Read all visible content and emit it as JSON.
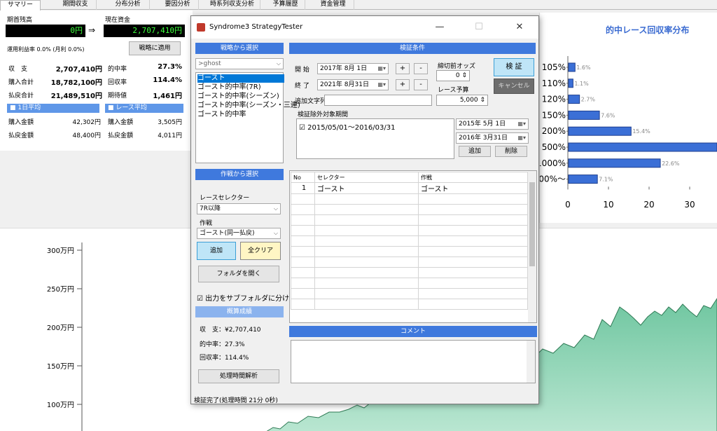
{
  "tabs": [
    "サマリー",
    "期間収支",
    "分布分析",
    "要因分析",
    "時系列収支分析",
    "予算履歴",
    "資金管理"
  ],
  "summary": {
    "initial_label": "期首残高",
    "initial_value": "0円",
    "current_label": "現在資金",
    "current_value": "2,707,410円",
    "arrow": "⇒",
    "rate_label": "運用利益率 0.0% (月利 0.0%)",
    "apply_button": "戦略に適用",
    "rows": [
      {
        "label": "収　支",
        "value": "2,707,410円",
        "label2": "的中率",
        "value2": "27.3%"
      },
      {
        "label": "購入合計",
        "value": "18,782,100円",
        "label2": "回収率",
        "value2": "114.4%"
      },
      {
        "label": "払戻合計",
        "value": "21,489,510円",
        "label2": "期待値",
        "value2": "1,461円"
      }
    ],
    "daily_avg_label": "■ 1日平均",
    "race_avg_label": "■ レース平均",
    "avg_rows": [
      {
        "label": "購入金額",
        "value": "42,302円",
        "label2": "購入金額",
        "value2": "3,505円"
      },
      {
        "label": "払戻金額",
        "value": "48,400円",
        "label2": "払戻金額",
        "value2": "4,011円"
      }
    ]
  },
  "window": {
    "title": "Syndrome3 StrategyTester",
    "minimize": "—",
    "maximize": "☐",
    "close": "✕",
    "strategy_select_header": "戦略から選択",
    "strategy_dropdown": ">ghost",
    "strategy_list": [
      "ゴースト",
      "ゴースト的中率(7R)",
      "ゴースト的中率(シーズン)",
      "ゴースト的中率(シーズン・三連)",
      "ゴースト的中率"
    ],
    "conditions_header": "検証条件",
    "start_label": "開 始",
    "start_date": "2017年 8月 1日",
    "end_label": "終 了",
    "end_date": "2021年 8月31日",
    "plus": "+",
    "minus": "-",
    "odds_label": "締切前オッズ",
    "odds_value": "0",
    "budget_label": "レース予算",
    "budget_value": "5,000",
    "extra_text_label": "追加文字列",
    "verify_button": "検 証",
    "cancel_button": "キャンセル",
    "exclude_label": "検証除外対象期間",
    "exclude_item": "2015/05/01～2016/03/31",
    "exclude_from": "2015年 5月 1日",
    "exclude_to": "2016年 3月31日",
    "add_button": "追加",
    "delete_button": "削除",
    "tactic_header": "作戦から選択",
    "race_selector_label": "レースセレクター",
    "race_selector_value": "7R以降",
    "tactic_label": "作戦",
    "tactic_value": "ゴースト(同一払戻)",
    "tactic_add_button": "追加",
    "clear_all_button": "全クリア",
    "open_folder_button": "フォルダを開く",
    "subfolder_checkbox": "出力をサブフォルダに分ける",
    "result_header": "概算成績",
    "result_profit": "収　支：¥2,707,410",
    "result_hit": "的中率：27.3%",
    "result_return": "回収率：114.4%",
    "analyze_button": "処理時間解析",
    "grid_headers": [
      "No",
      "セレクター",
      "作戦"
    ],
    "grid_rows": [
      [
        "1",
        "ゴースト",
        "ゴースト"
      ]
    ],
    "comment_header": "コメント",
    "status": "検証完了(処理時間 21分 0秒)"
  },
  "bar_chart_title": "的中レース回収率分布",
  "area_chart_ticks": [
    "300万円",
    "250万円",
    "200万円",
    "150万円",
    "100万円"
  ],
  "chart_data": {
    "type": "bar",
    "title": "的中レース回収率分布",
    "categories": [
      "105%",
      "110%",
      "120%",
      "150%",
      "200%",
      "500%",
      "1000%",
      "00%～"
    ],
    "values": [
      1.6,
      1.1,
      2.7,
      7.6,
      15.4,
      37.0,
      22.6,
      7.1
    ],
    "value_labels": [
      "1.6%",
      "1.1%",
      "2.7%",
      "7.6%",
      "15.4%",
      "",
      "22.6%",
      "7.1%"
    ],
    "xticks": [
      "0",
      "10",
      "20",
      "30"
    ],
    "xlim": [
      0,
      36
    ],
    "bar_color": "#3b6fd6"
  }
}
